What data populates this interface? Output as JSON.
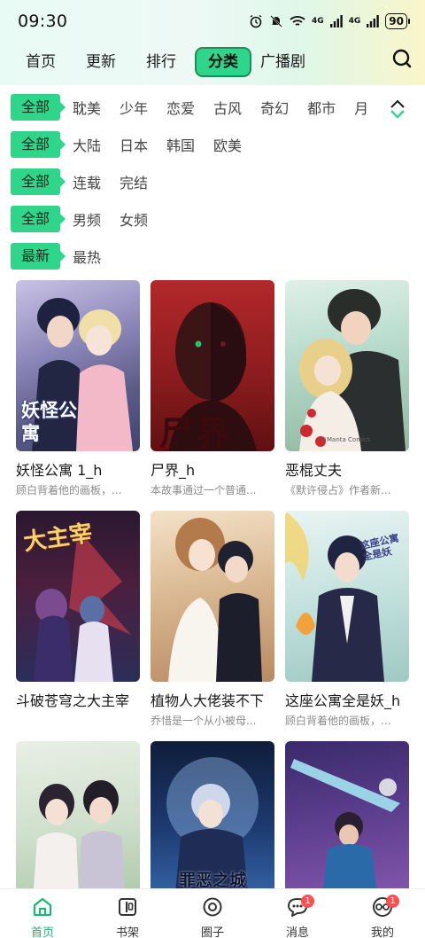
{
  "status_bar": {
    "time": "09:30",
    "battery": "90",
    "signal1": "4G",
    "signal2": "4G",
    "wifi": "6"
  },
  "top_nav": {
    "tabs": [
      {
        "label": "首页"
      },
      {
        "label": "更新"
      },
      {
        "label": "排行"
      },
      {
        "label": "分类",
        "active": true
      },
      {
        "label": "广播剧"
      }
    ],
    "search_icon": "search-icon"
  },
  "filters": {
    "genre": {
      "all": "全部",
      "options": [
        "耽美",
        "少年",
        "恋爱",
        "古风",
        "奇幻",
        "都市",
        "月"
      ]
    },
    "region": {
      "all": "全部",
      "options": [
        "大陆",
        "日本",
        "韩国",
        "欧美"
      ]
    },
    "status": {
      "all": "全部",
      "options": [
        "连载",
        "完结"
      ]
    },
    "audience": {
      "all": "全部",
      "options": [
        "男频",
        "女频"
      ]
    },
    "sort": {
      "selected": "最新",
      "options": [
        "最热"
      ]
    },
    "expand_icon": "expand-collapse-icon"
  },
  "comics": [
    {
      "title": "妖怪公寓 1_h",
      "desc": "顾白背着他的画板，...",
      "cover_text": "妖怪公寓"
    },
    {
      "title": "尸界_h",
      "desc": "本故事通过一个普通...",
      "cover_text": "尸界"
    },
    {
      "title": "恶棍丈夫",
      "desc": "《默许侵占》作者新...",
      "cover_text": "©Manta Comics"
    },
    {
      "title": "斗破苍穹之大主宰",
      "desc": "",
      "cover_text": "大主宰"
    },
    {
      "title": "植物人大佬装不下",
      "desc": "乔惜是一个从小被母...",
      "cover_text": ""
    },
    {
      "title": "这座公寓全是妖_h",
      "desc": "顾白背着他的画板，...",
      "cover_text": "这座公寓全是妖"
    },
    {
      "title": "",
      "desc": "",
      "cover_text": ""
    },
    {
      "title": "",
      "desc": "",
      "cover_text": "罪恶之城"
    },
    {
      "title": "",
      "desc": "",
      "cover_text": ""
    }
  ],
  "bottom_nav": {
    "items": [
      {
        "label": "首页",
        "icon": "home-icon",
        "active": true
      },
      {
        "label": "书架",
        "icon": "bookshelf-icon"
      },
      {
        "label": "圈子",
        "icon": "circle-icon"
      },
      {
        "label": "消息",
        "icon": "message-icon",
        "badge": "1"
      },
      {
        "label": "我的",
        "icon": "profile-icon",
        "badge": "1"
      }
    ]
  },
  "colors": {
    "accent": "#2ed58b",
    "accent_dark": "#1c8d5c",
    "badge": "#ff4f4f"
  }
}
